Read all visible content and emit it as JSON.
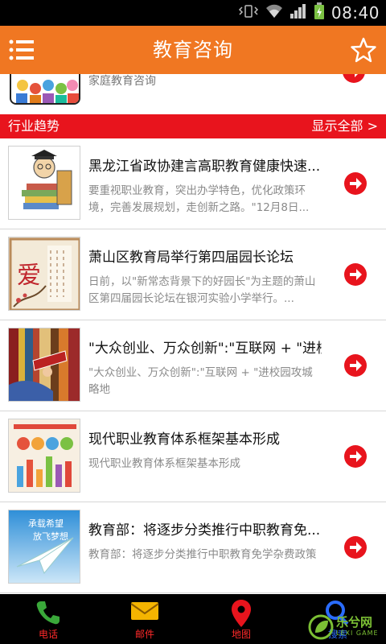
{
  "status_bar": {
    "time": "08:40"
  },
  "header": {
    "title": "教育咨询"
  },
  "partial_item": {
    "description": "家庭教育咨询"
  },
  "section": {
    "title": "行业趋势",
    "more_label": "显示全部 >"
  },
  "news": [
    {
      "title": "黑龙江省政协建言高职教育健康快速...",
      "description": "要重视职业教育，突出办学特色，优化政策环境，完善发展规划，走创新之路。\"12月8日..."
    },
    {
      "title": "萧山区教育局举行第四届园长论坛",
      "description": "日前，以\"新常态背景下的好园长\"为主题的萧山区第四届园长论坛在银河实验小学举行。..."
    },
    {
      "title": "\"大众创业、万众创新\":\"互联网 + \"进校...",
      "description": "\"大众创业、万众创新\":\"互联网 + \"进校园攻城略地"
    },
    {
      "title": "现代职业教育体系框架基本形成",
      "description": "现代职业教育体系框架基本形成"
    },
    {
      "title": "教育部：将逐步分类推行中职教育免...",
      "description": "教育部：将逐步分类推行中职教育免学杂费政策"
    }
  ],
  "thumb_text": {
    "love": "爱",
    "dream_line1": "承载希望",
    "dream_line2": "放飞梦想"
  },
  "bottom_nav": [
    {
      "label": "电话",
      "icon": "phone-icon"
    },
    {
      "label": "邮件",
      "icon": "mail-icon"
    },
    {
      "label": "地图",
      "icon": "map-pin-icon"
    },
    {
      "label": "搜索",
      "icon": "search-icon"
    }
  ],
  "watermark": {
    "name": "乐兮网",
    "sub": "LEXI GAME"
  },
  "colors": {
    "header": "#f07722",
    "section_bar": "#e8141d",
    "arrow": "#e8141d",
    "status_bar": "#000000"
  }
}
